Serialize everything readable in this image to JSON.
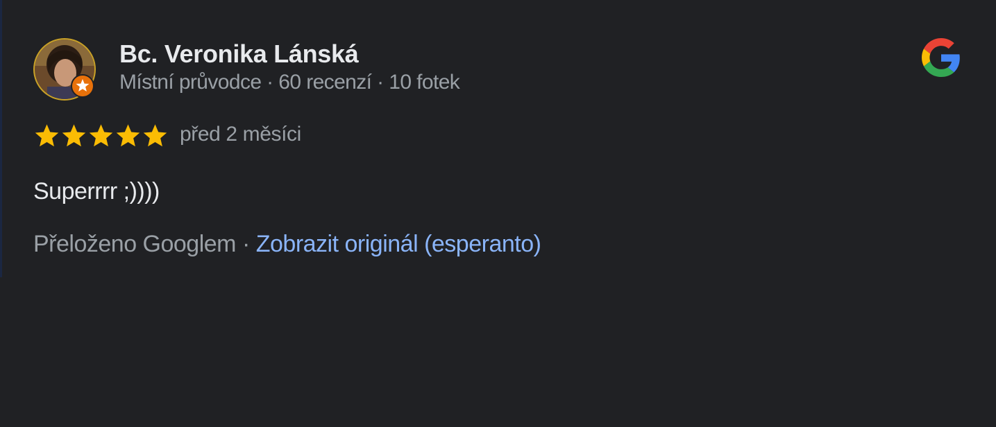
{
  "review": {
    "reviewer": {
      "name": "Bc. Veronika Lánská",
      "meta": "Místní průvodce · 60 recenzí · 10 fotek",
      "badge_icon": "local-guide-star-icon"
    },
    "rating": 5,
    "rating_max": 5,
    "date": "před 2 měsíci",
    "text": "Superrrr ;))))",
    "translation": {
      "translated_by": "Přeloženo Googlem",
      "separator": " · ",
      "show_original": "Zobrazit originál (esperanto)"
    },
    "source_icon": "google-logo-icon"
  },
  "colors": {
    "background": "#202124",
    "text_primary": "#e8eaed",
    "text_secondary": "#9aa0a6",
    "link": "#8ab4f8",
    "star": "#fbbc04",
    "badge": "#e8710a"
  }
}
